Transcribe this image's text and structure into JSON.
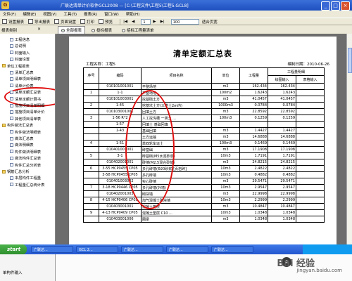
{
  "window": {
    "title": "广联达清单计价软件GCL2008 — [C:\\工程文件\\工程5\\工程5.GCL8]",
    "icon_label": "G"
  },
  "menu": [
    "文件(F)",
    "编辑(E)",
    "视图(V)",
    "工具(T)",
    "报表(R)",
    "窗口(W)",
    "帮助(H)"
  ],
  "toolbar": {
    "buttons": [
      "设置报表",
      "导出报表",
      "页面设置",
      "打印",
      "预览"
    ],
    "page_info": "1",
    "zoom": "100",
    "fit_label": "适合页宽"
  },
  "subtoolbar": {
    "sidebar_title": "报表类别",
    "tabs": [
      {
        "label": "全部报表",
        "checked": true
      },
      {
        "label": "投标报表",
        "checked": false
      },
      {
        "label": "招标工程量清单",
        "checked": false
      }
    ]
  },
  "sidebar": {
    "items": [
      {
        "label": "工程信息",
        "level": 2
      },
      {
        "label": "总说明",
        "level": 2
      },
      {
        "label": "封面输入",
        "level": 2
      },
      {
        "label": "封面设置",
        "level": 2
      },
      {
        "label": "单位工程报表",
        "level": 1
      },
      {
        "label": "清单汇总表",
        "level": 2
      },
      {
        "label": "清单项目明细表",
        "level": 2
      },
      {
        "label": "清单计价表",
        "level": 2
      },
      {
        "label": "清单定额汇总表",
        "level": 2
      },
      {
        "label": "清单定额计算书",
        "level": 2
      },
      {
        "label": "措施项目清单明细",
        "level": 2
      },
      {
        "label": "措施项目清单计价",
        "level": 2
      },
      {
        "label": "其他项目清单表",
        "level": 2
      },
      {
        "label": "构件做法汇总表",
        "level": 1
      },
      {
        "label": "构件做法明细表",
        "level": 2
      },
      {
        "label": "做法汇总表",
        "level": 2
      },
      {
        "label": "做法明细表",
        "level": 2
      },
      {
        "label": "构件做法明细表",
        "level": 2
      },
      {
        "label": "做法构件汇总表",
        "level": 2
      },
      {
        "label": "构件汇总分析表",
        "level": 2
      },
      {
        "label": "钢筋汇总分析",
        "level": 1
      },
      {
        "label": "本层构件工程量",
        "level": 2
      },
      {
        "label": "工程量汇总统计表",
        "level": 2
      }
    ]
  },
  "report": {
    "title": "清单定额汇总表",
    "project_label": "工程名称：工程5",
    "print_date": "编制日期：2010-06-26",
    "headers": {
      "seq": "序号",
      "code": "编码",
      "name": "项目名称",
      "unit": "单位",
      "qty": "工程量",
      "group": "工程量明细",
      "manual": "绘图输入",
      "table_in": "表格输入"
    },
    "rows": [
      {
        "seq": "",
        "code": "010101001001",
        "name": "平整场地",
        "unit": "m2",
        "qty": "162.434",
        "manual": "162.434",
        "table_in": ""
      },
      {
        "seq": "1",
        "code": "1-1",
        "name": "平整场地",
        "unit": "100m2",
        "qty": "1.6243",
        "manual": "1.6243",
        "table_in": ""
      },
      {
        "seq": "",
        "code": "010101003001",
        "name": "挖基础土方",
        "unit": "m3",
        "qty": "41.0457",
        "manual": "41.0457",
        "table_in": ""
      },
      {
        "seq": "2",
        "code": "1-45",
        "name": "挖基坑土方(三类土2m内)",
        "unit": "1000m3",
        "qty": "0.0784",
        "manual": "0.0784",
        "table_in": ""
      },
      {
        "seq": "",
        "code": "010103001001",
        "name": "回填土方",
        "unit": "m3",
        "qty": "22.8592",
        "manual": "22.8592",
        "table_in": ""
      },
      {
        "seq": "3",
        "code": "1-56 R*2",
        "name": "人工挖沟槽 一类土 ...",
        "unit": "100m3",
        "qty": "0.1259",
        "manual": "0.1259",
        "table_in": ""
      },
      {
        "seq": "",
        "code": "1-57",
        "name": "回填土 基础回填",
        "unit": "",
        "qty": "",
        "manual": "",
        "table_in": ""
      },
      {
        "seq": "",
        "code": "1-43",
        "name": "基础回填",
        "unit": "m3",
        "qty": "1.4427",
        "manual": "1.4427",
        "table_in": ""
      },
      {
        "seq": "",
        "code": "",
        "name": "土方运输",
        "unit": "m3",
        "qty": "14.6888",
        "manual": "14.6888",
        "table_in": ""
      },
      {
        "seq": "4",
        "code": "1-51",
        "name": "单双轮车运土",
        "unit": "100m3",
        "qty": "0.1469",
        "manual": "0.1469",
        "table_in": ""
      },
      {
        "seq": "",
        "code": "010401001001",
        "name": "砖基础",
        "unit": "m3",
        "qty": "17.1908",
        "manual": "17.1908",
        "table_in": ""
      },
      {
        "seq": "5",
        "code": "3-1",
        "name": "砖基础(M5水泥砂浆)",
        "unit": "10m3",
        "qty": "1.7191",
        "manual": "1.7191",
        "table_in": ""
      },
      {
        "seq": "",
        "code": "010402001001",
        "name": "砖墙(M2.5混合砂浆)",
        "unit": "m3",
        "qty": "24.8215",
        "manual": "24.8215",
        "table_in": ""
      },
      {
        "seq": "6",
        "code": "3-55 HCP0455 CP05",
        "name": "多孔砖墙(Φ20砂浆)[页岩砖]",
        "unit": "10m3",
        "qty": "2.4822",
        "manual": "2.4822",
        "table_in": ""
      },
      {
        "seq": "",
        "code": "3-58 HCP0455 CP05",
        "name": "多孔砖墙",
        "unit": "10m3",
        "qty": "0.4882",
        "manual": "0.4882",
        "table_in": ""
      },
      {
        "seq": "",
        "code": "010401003002",
        "name": "实心砖墙",
        "unit": "m3",
        "qty": "29.5471",
        "manual": "29.5471",
        "table_in": ""
      },
      {
        "seq": "7",
        "code": "3-18 HCP0446 CP05",
        "name": "多孔砖墙(外墙)",
        "unit": "10m3",
        "qty": "2.9547",
        "manual": "2.9547",
        "table_in": ""
      },
      {
        "seq": "",
        "code": "010402001003",
        "name": "砌块墙",
        "unit": "m3",
        "qty": "22.9998",
        "manual": "22.9998",
        "table_in": ""
      },
      {
        "seq": "8",
        "code": "4-15 HCP0406 CP05",
        "name": "加气混凝土砌块墙",
        "unit": "10m3",
        "qty": "2.2999",
        "manual": "2.2999",
        "table_in": ""
      },
      {
        "seq": "",
        "code": "010403001001",
        "name": "混凝土垫层",
        "unit": "m3",
        "qty": "10.4847",
        "manual": "10.4847",
        "table_in": ""
      },
      {
        "seq": "9",
        "code": "4-13 HCP0409 CP05",
        "name": "混凝土垫层 C10 ...",
        "unit": "10m3",
        "qty": "1.0348",
        "manual": "1.0348",
        "table_in": ""
      },
      {
        "seq": "",
        "code": "010403001006",
        "name": "圈梁",
        "unit": "m3",
        "qty": "1.0348",
        "manual": "1.0348",
        "table_in": ""
      }
    ]
  },
  "taskbar": {
    "start_label": "start",
    "tasks": [
      "广联达...",
      "GCL 2...",
      "广联达...",
      "广联达...",
      "广联达..."
    ]
  },
  "bottom": {
    "left_label": "单构件输入",
    "watermark": "Bai 经验",
    "watermark_sub": "jingyan.baidu.com"
  }
}
